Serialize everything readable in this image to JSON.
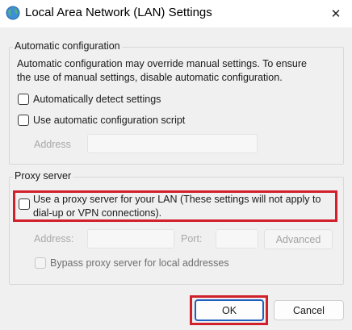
{
  "window": {
    "title": "Local Area Network (LAN) Settings",
    "close_glyph": "✕",
    "icon": "network-globe-icon"
  },
  "auto_config": {
    "legend": "Automatic configuration",
    "description_line1": "Automatic configuration may override manual settings.  To ensure",
    "description_line2": "the use of manual settings, disable automatic configuration.",
    "detect_label": "Automatically detect settings",
    "detect_checked": false,
    "script_label": "Use automatic configuration script",
    "script_checked": false,
    "address_label": "Address",
    "address_value": ""
  },
  "proxy": {
    "legend": "Proxy server",
    "use_proxy_line1": "Use a proxy server for your LAN (These settings will not apply to",
    "use_proxy_line2": "dial-up or VPN connections).",
    "use_proxy_checked": false,
    "address_label": "Address:",
    "address_value": "",
    "port_label": "Port:",
    "port_value": "",
    "advanced_label": "Advanced",
    "bypass_label": "Bypass proxy server for local addresses",
    "bypass_checked": false
  },
  "footer": {
    "ok_label": "OK",
    "cancel_label": "Cancel"
  },
  "annotation_color": "#d1202c"
}
